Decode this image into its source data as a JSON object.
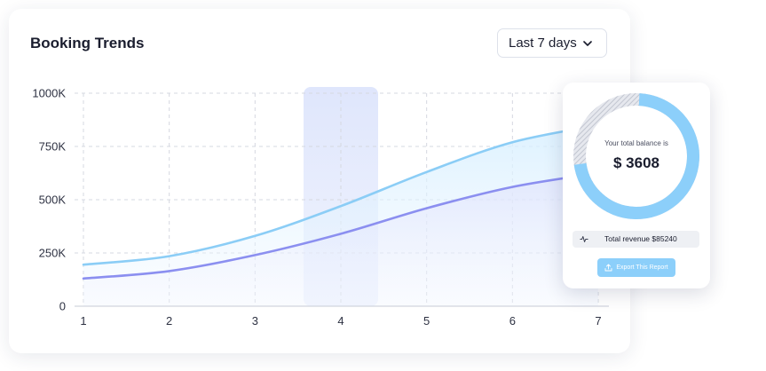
{
  "card": {
    "title": "Booking Trends",
    "range_select": {
      "value": "Last 7 days",
      "icon": "chevron-down-icon"
    }
  },
  "chart_data": {
    "type": "area",
    "title": "",
    "xlabel": "",
    "ylabel": "",
    "x": [
      1,
      2,
      3,
      4,
      5,
      6,
      7
    ],
    "x_tick_labels": [
      "1",
      "2",
      "3",
      "4",
      "5",
      "6",
      "7"
    ],
    "y_tick_labels": [
      "0",
      "250K",
      "500K",
      "750K",
      "1000K"
    ],
    "y_ticks": [
      0,
      250000,
      500000,
      750000,
      1000000
    ],
    "ylim": [
      0,
      1000000
    ],
    "xlim": [
      1,
      7
    ],
    "grid": true,
    "highlight_x": 4,
    "series": [
      {
        "color": "#8bcdf6",
        "values": [
          195000,
          235000,
          330000,
          470000,
          630000,
          770000,
          850000
        ]
      },
      {
        "color": "#8b8ff0",
        "values": [
          130000,
          165000,
          240000,
          340000,
          460000,
          560000,
          625000
        ]
      }
    ]
  },
  "balance": {
    "caption": "Your total balance is",
    "value": "$ 3608",
    "donut_fraction": 0.72,
    "colors": {
      "primary": "#8ccffa",
      "remainder": "#c9ccd6"
    }
  },
  "revenue": {
    "label": "Total revenue $85240",
    "icon": "activity-pulse-icon"
  },
  "export": {
    "label": "Export This Report",
    "icon": "upload-icon"
  }
}
